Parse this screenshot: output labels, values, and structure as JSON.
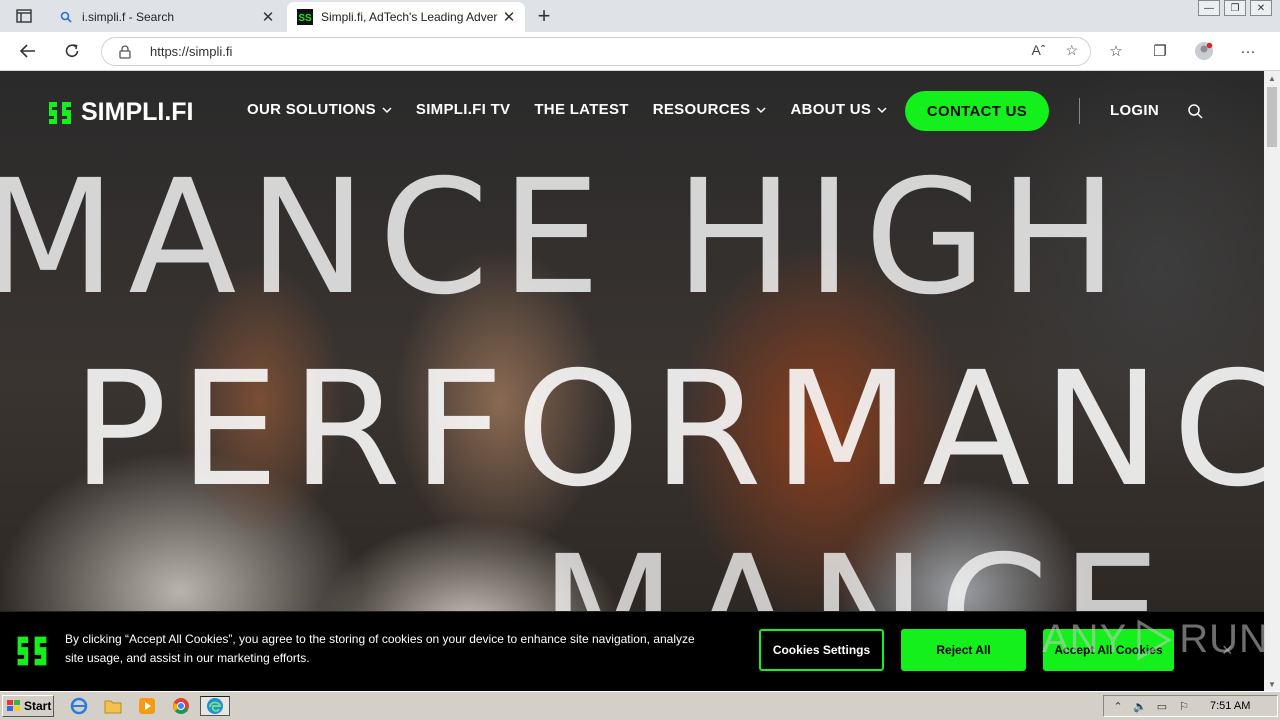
{
  "browser": {
    "tabs": [
      {
        "title": "i.simpli.f - Search",
        "icon": "search-icon",
        "active": false
      },
      {
        "title": "Simpli.fi, AdTech's Leading Adver",
        "icon": "simplifi-favicon",
        "active": true
      }
    ],
    "url": "https://simpli.fi",
    "read_aloud_glyph": "Aˆ"
  },
  "site": {
    "logo_text": "SIMPLI.FI",
    "brand_color": "#14f01b",
    "nav": [
      {
        "label": "OUR SOLUTIONS",
        "dropdown": true
      },
      {
        "label": "SIMPLI.FI TV",
        "dropdown": false
      },
      {
        "label": "THE LATEST",
        "dropdown": false
      },
      {
        "label": "RESOURCES",
        "dropdown": true
      },
      {
        "label": "ABOUT US",
        "dropdown": true
      }
    ],
    "contact_label": "CONTACT US",
    "login_label": "LOGIN",
    "hero_lines": [
      "MANCE HIGH",
      "PERFORMANC",
      "MANCE"
    ]
  },
  "cookie_banner": {
    "text": "By clicking “Accept All Cookies”, you agree to the storing of cookies on your device to enhance site navigation, analyze site usage, and assist in our marketing efforts.",
    "settings_label": "Cookies Settings",
    "reject_label": "Reject All",
    "accept_label": "Accept All Cookies",
    "close_glyph": "×"
  },
  "watermark": {
    "left": "ANY",
    "right": "RUN"
  },
  "taskbar": {
    "start_label": "Start",
    "clock": "7:51 AM"
  }
}
